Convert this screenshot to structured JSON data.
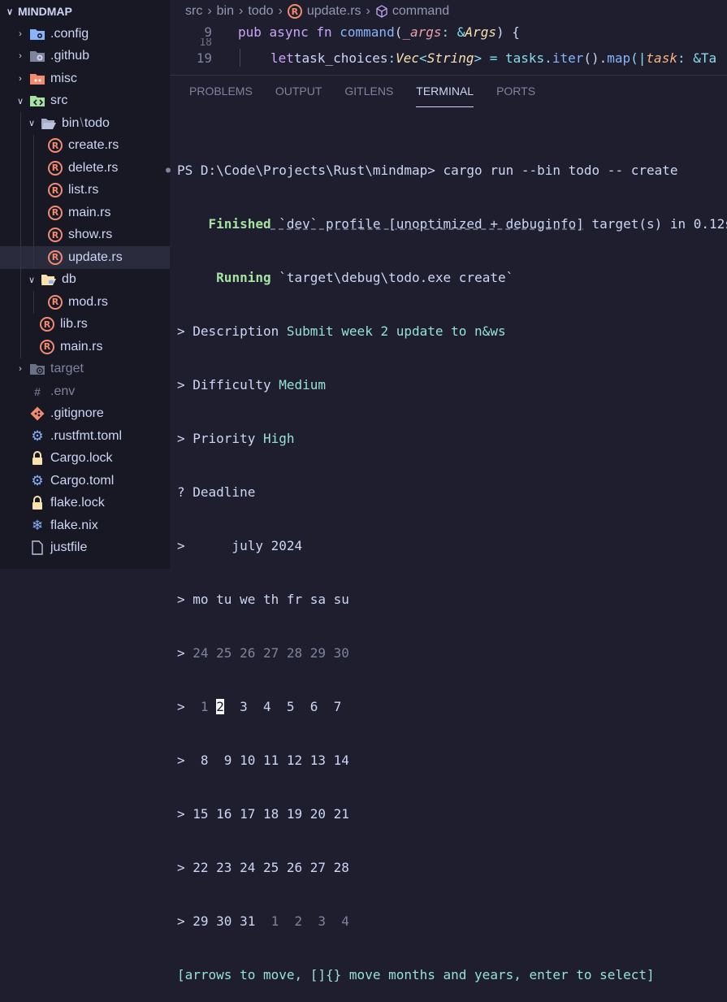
{
  "explorer": {
    "title": "MINDMAP",
    "items": [
      {
        "label": ".config",
        "icon": "config-folder-icon",
        "color": "#89b4fa"
      },
      {
        "label": ".github",
        "icon": "github-folder-icon",
        "color": "#a6adc8"
      },
      {
        "label": "misc",
        "icon": "misc-folder-icon",
        "color": "#f38b70"
      },
      {
        "label": "src",
        "icon": "src-folder-icon",
        "color": "#a6e3a1"
      },
      {
        "label": "bin",
        "label2": "todo",
        "icon": "folder-open-icon"
      },
      {
        "label": "create.rs"
      },
      {
        "label": "delete.rs"
      },
      {
        "label": "list.rs"
      },
      {
        "label": "main.rs"
      },
      {
        "label": "show.rs"
      },
      {
        "label": "update.rs"
      },
      {
        "label": "db",
        "icon": "db-folder-icon"
      },
      {
        "label": "mod.rs"
      },
      {
        "label": "lib.rs"
      },
      {
        "label": "main.rs"
      },
      {
        "label": "target"
      },
      {
        "label": ".env"
      },
      {
        "label": ".gitignore"
      },
      {
        "label": ".rustfmt.toml"
      },
      {
        "label": "Cargo.lock"
      },
      {
        "label": "Cargo.toml"
      },
      {
        "label": "flake.lock"
      },
      {
        "label": "flake.nix"
      },
      {
        "label": "justfile"
      }
    ],
    "rust_glyph": "R"
  },
  "breadcrumb": {
    "p1": "src",
    "p2": "bin",
    "p3": "todo",
    "p4": "update.rs",
    "p5": "command",
    "sep": "›"
  },
  "code": {
    "line9_num": "9",
    "line18_num": "18",
    "line19_num": "19",
    "l9": {
      "a": "pub",
      "b": "async",
      "c": "fn",
      "d": "command",
      "e": "(",
      "f": "_args",
      "g": ": &",
      "h": "Args",
      "i": ") {"
    },
    "l19": {
      "a": "let",
      "b": " task_choices",
      "c": ": ",
      "d": "Vec",
      "e": "<",
      "f": "String",
      "g": "> = tasks.",
      "h": "iter",
      "i": "().",
      "j": "map",
      "k": "(|",
      "l": "task",
      "m": ": &Ta"
    }
  },
  "panel_tabs": {
    "problems": "PROBLEMS",
    "output": "OUTPUT",
    "gitlens": "GITLENS",
    "terminal": "TERMINAL",
    "ports": "PORTS"
  },
  "terminal": {
    "prompt": "PS D:\\Code\\Projects\\Rust\\mindmap> ",
    "command": "cargo run --bin todo -- create",
    "finished_label": "Finished",
    "finished_a": " `dev` profile [unoptimized + debuginfo]",
    "finished_b": " target(s) in 0.12s",
    "running_label": "Running",
    "running_text": " `target\\debug\\todo.exe create`",
    "desc_label": "> Description ",
    "desc_value": "Submit week 2 update to n&ws",
    "diff_label": "> Difficulty ",
    "diff_value": "Medium",
    "prio_label": "> Priority ",
    "prio_value": "High",
    "deadline_label": "? Deadline",
    "month": ">      july 2024",
    "dow": "> mo tu we th fr sa su",
    "week0_prefix": "> ",
    "week0": "24 25 26 27 28 29 30",
    "week1_prefix": ">  ",
    "week1_d1": "1",
    "week1_sel": "2",
    "week1_rest": "  3  4  5  6  7",
    "week2": ">  8  9 10 11 12 13 14",
    "week3": "> 15 16 17 18 19 20 21",
    "week4": "> 22 23 24 25 26 27 28",
    "week5_prefix": "> ",
    "week5_a": "29 30 31",
    "week5_b": "  1  2  3  4",
    "help": "[arrows to move, []{} move months and years, enter to select]"
  }
}
